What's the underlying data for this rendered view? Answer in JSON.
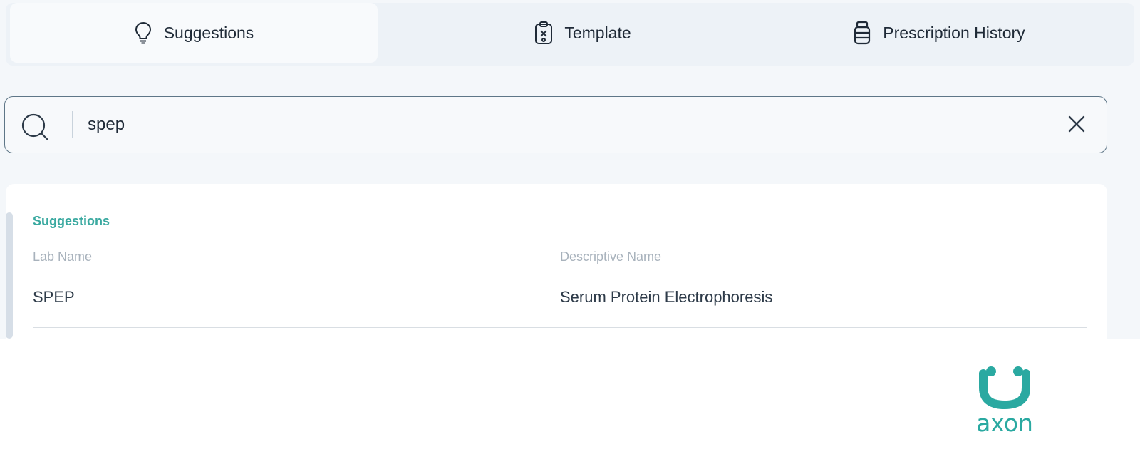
{
  "tabs": [
    {
      "label": "Suggestions",
      "icon": "lightbulb-icon",
      "active": true
    },
    {
      "label": "Template",
      "icon": "clipboard-icon",
      "active": false
    },
    {
      "label": "Prescription History",
      "icon": "pill-bottle-icon",
      "active": false
    }
  ],
  "search": {
    "value": "spep",
    "search_icon": "search-icon",
    "clear_icon": "close-icon"
  },
  "results": {
    "section_title": "Suggestions",
    "columns": {
      "lab_name": "Lab Name",
      "descriptive_name": "Descriptive Name"
    },
    "rows": [
      {
        "lab_name": "SPEP",
        "descriptive_name": "Serum Protein Electrophoresis"
      }
    ]
  },
  "brand": {
    "logo_text": "axon",
    "color": "#2aa9a1",
    "accent": "#3aa9a0"
  }
}
